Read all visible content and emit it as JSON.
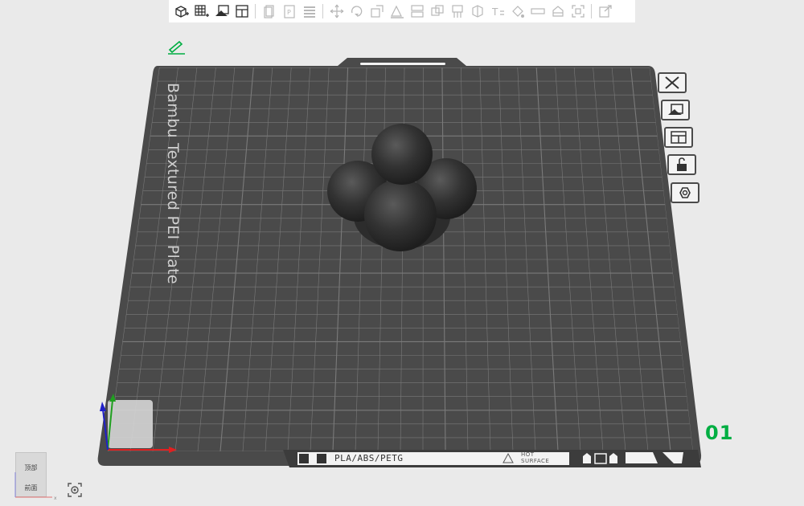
{
  "toolbar": {
    "items": [
      {
        "name": "add-object",
        "icon": "cube-plus-icon",
        "enabled": true
      },
      {
        "name": "add-plate",
        "icon": "grid-plus-icon",
        "enabled": true
      },
      {
        "name": "auto-orient",
        "icon": "auto-orient-icon",
        "enabled": true
      },
      {
        "name": "arrange",
        "icon": "arrange-icon",
        "enabled": true
      },
      {
        "name": "copy",
        "icon": "copy-icon",
        "enabled": false
      },
      {
        "name": "paste",
        "icon": "paste-icon",
        "enabled": false
      },
      {
        "name": "layers",
        "icon": "layers-icon",
        "enabled": false
      },
      {
        "name": "move",
        "icon": "move-icon",
        "enabled": false
      },
      {
        "name": "rotate",
        "icon": "rotate-icon",
        "enabled": false
      },
      {
        "name": "scale",
        "icon": "scale-icon",
        "enabled": false
      },
      {
        "name": "lay-on-face",
        "icon": "lay-on-face-icon",
        "enabled": false
      },
      {
        "name": "cut",
        "icon": "cut-icon",
        "enabled": false
      },
      {
        "name": "boolean",
        "icon": "boolean-icon",
        "enabled": false
      },
      {
        "name": "support-paint",
        "icon": "support-paint-icon",
        "enabled": false
      },
      {
        "name": "seam-paint",
        "icon": "seam-paint-icon",
        "enabled": false
      },
      {
        "name": "text",
        "icon": "text-icon",
        "enabled": false
      },
      {
        "name": "color-paint",
        "icon": "color-paint-icon",
        "enabled": false
      },
      {
        "name": "measure",
        "icon": "measure-icon",
        "enabled": false
      },
      {
        "name": "assembly",
        "icon": "assembly-icon",
        "enabled": false
      },
      {
        "name": "fit-view",
        "icon": "fit-view-icon",
        "enabled": false
      },
      {
        "name": "variable-layer",
        "icon": "variable-layer-icon",
        "enabled": false
      }
    ]
  },
  "plate": {
    "label": "Bambu Textured PEI Plate",
    "number": "01",
    "filament_types": "PLA/ABS/PETG",
    "hot_line1": "HOT",
    "hot_line2": "SURFACE"
  },
  "side_buttons": [
    {
      "name": "delete-plate",
      "icon": "close-icon"
    },
    {
      "name": "auto-arrange",
      "icon": "auto-orient-icon"
    },
    {
      "name": "arrange-plate",
      "icon": "arrange-icon"
    },
    {
      "name": "lock-plate",
      "icon": "unlock-icon"
    },
    {
      "name": "plate-settings",
      "icon": "hexagon-nut-icon"
    }
  ],
  "viewcube": {
    "top": "顶部",
    "front": "前面"
  },
  "colors": {
    "accent": "#00ae42",
    "plate": "#4a4a4a",
    "grid": "#7a7a7a",
    "model": "#2e2e2e",
    "x_axis": "#e02020",
    "y_axis": "#20a020",
    "z_axis": "#2020c8"
  }
}
